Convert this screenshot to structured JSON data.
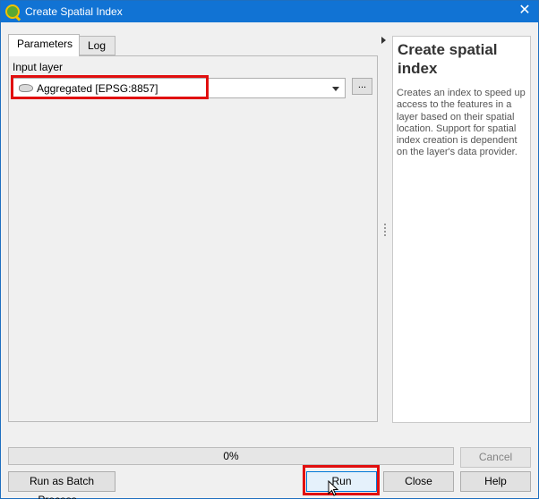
{
  "window": {
    "title": "Create Spatial Index"
  },
  "tabs": [
    {
      "label": "Parameters",
      "active": true
    },
    {
      "label": "Log",
      "active": false
    }
  ],
  "parameters": {
    "input_layer_label": "Input layer",
    "input_layer_value": "Aggregated [EPSG:8857]",
    "browse_label": "..."
  },
  "help": {
    "title": "Create spatial index",
    "description": "Creates an index to speed up access to the features in a layer based on their spatial location. Support for spatial index creation is dependent on the layer's data provider."
  },
  "progress": {
    "text": "0%",
    "value": 0
  },
  "buttons": {
    "cancel": "Cancel",
    "batch": "Run as Batch Process...",
    "run": "Run",
    "close": "Close",
    "help": "Help"
  },
  "colors": {
    "titlebar": "#1173d4",
    "highlight": "#e10f0f"
  }
}
